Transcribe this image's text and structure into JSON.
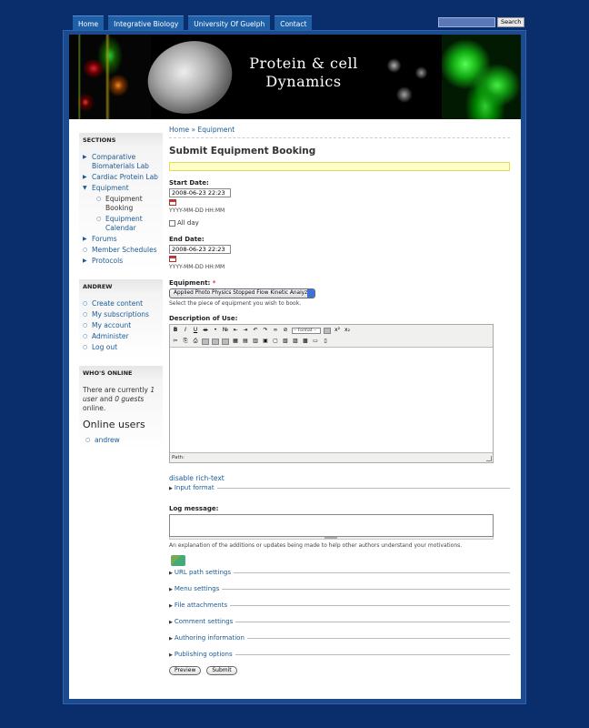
{
  "topnav": {
    "tabs": [
      "Home",
      "Integrative Biology",
      "University Of Guelph",
      "Contact"
    ]
  },
  "search": {
    "button_label": "Search",
    "value": ""
  },
  "banner": {
    "title_line1": "Protein & cell",
    "title_line2": "Dynamics"
  },
  "sidebar": {
    "sections_title": "Sections",
    "sections": [
      {
        "label": "Comparative Biomaterials Lab",
        "marker": "collapsed"
      },
      {
        "label": "Cardiac Protein Lab",
        "marker": "collapsed"
      },
      {
        "label": "Equipment",
        "marker": "expanded"
      },
      {
        "label": "Equipment Booking",
        "marker": "leaf",
        "sub": true,
        "active": true
      },
      {
        "label": "Equipment Calendar",
        "marker": "leaf",
        "sub": true
      },
      {
        "label": "Forums",
        "marker": "collapsed"
      },
      {
        "label": "Member Schedules",
        "marker": "leaf"
      },
      {
        "label": "Protocols",
        "marker": "collapsed"
      }
    ],
    "user_title": "andrew",
    "user_links": [
      "Create content",
      "My subscriptions",
      "My account",
      "Administer",
      "Log out"
    ],
    "online_title": "Who's online",
    "online_text_pre": "There are currently ",
    "online_users_count": "1 user",
    "online_text_mid": " and ",
    "online_guests_count": "0 guests",
    "online_text_post": " online.",
    "online_users_heading": "Online users",
    "online_users": [
      "andrew"
    ]
  },
  "main": {
    "breadcrumb": {
      "home": "Home",
      "sep": " » ",
      "current": "Equipment"
    },
    "title": "Submit Equipment Booking",
    "start_date": {
      "label": "Start Date:",
      "value": "2008-06-23 22:23",
      "format": "YYYY-MM-DD HH:MM"
    },
    "all_day": {
      "label": "All day"
    },
    "end_date": {
      "label": "End Date:",
      "value": "2008-06-23 22:23",
      "format": "YYYY-MM-DD HH:MM"
    },
    "equipment": {
      "label": "Equipment:",
      "required_mark": "*",
      "selected": "Applied Photo Physics Stopped Flow Kinetic Analyzer",
      "description": "Select the piece of equipment you wish to book."
    },
    "description_of_use": {
      "label": "Description of Use:",
      "font_select": "-- Format --",
      "path_label": "Path:"
    },
    "disable_rich_text": "disable rich-text",
    "input_format": "Input format",
    "log_message": {
      "label": "Log message:",
      "description": "An explanation of the additions or updates being made to help other authors understand your motivations."
    },
    "fieldsets": [
      "URL path settings",
      "Menu settings",
      "File attachments",
      "Comment settings"
    ],
    "fieldsets2": [
      "Authoring information",
      "Publishing options"
    ],
    "buttons": {
      "preview": "Preview",
      "submit": "Submit"
    }
  }
}
